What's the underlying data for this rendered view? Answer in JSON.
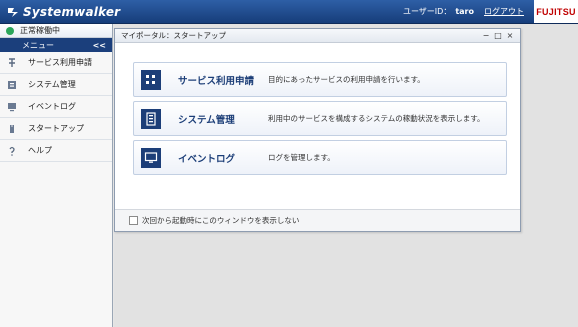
{
  "header": {
    "logo_text": "Systemwalker",
    "user_label": "ユーザーID：",
    "user_name": "taro",
    "logout_label": "ログアウト",
    "brand": "FUJITSU"
  },
  "sidebar": {
    "status_text": "正常稼働中",
    "menu_label": "メニュー",
    "collapse_symbol": "<<",
    "items": [
      {
        "label": "サービス利用申請",
        "icon": "service-request-icon"
      },
      {
        "label": "システム管理",
        "icon": "system-management-icon"
      },
      {
        "label": "イベントログ",
        "icon": "event-log-icon"
      },
      {
        "label": "スタートアップ",
        "icon": "startup-icon"
      },
      {
        "label": "ヘルプ",
        "icon": "help-icon"
      }
    ]
  },
  "portal": {
    "title": "マイポータル：スタートアップ",
    "window_controls": [
      "−",
      "□",
      "×"
    ],
    "cards": [
      {
        "title": "サービス利用申請",
        "description": "目的にあったサービスの利用申請を行います。",
        "icon": "service-request-icon"
      },
      {
        "title": "システム管理",
        "description": "利用中のサービスを構成するシステムの稼動状況を表示します。",
        "icon": "system-management-icon"
      },
      {
        "title": "イベントログ",
        "description": "ログを管理します。",
        "icon": "event-log-icon"
      }
    ],
    "footer_checkbox_label": "次回から起動時にこのウィンドウを表示しない",
    "footer_checked": false
  },
  "colors": {
    "header": "#1f4a8e",
    "accent": "#1c3e78",
    "status_ok": "#2aa55a",
    "brand_red": "#c00000"
  }
}
